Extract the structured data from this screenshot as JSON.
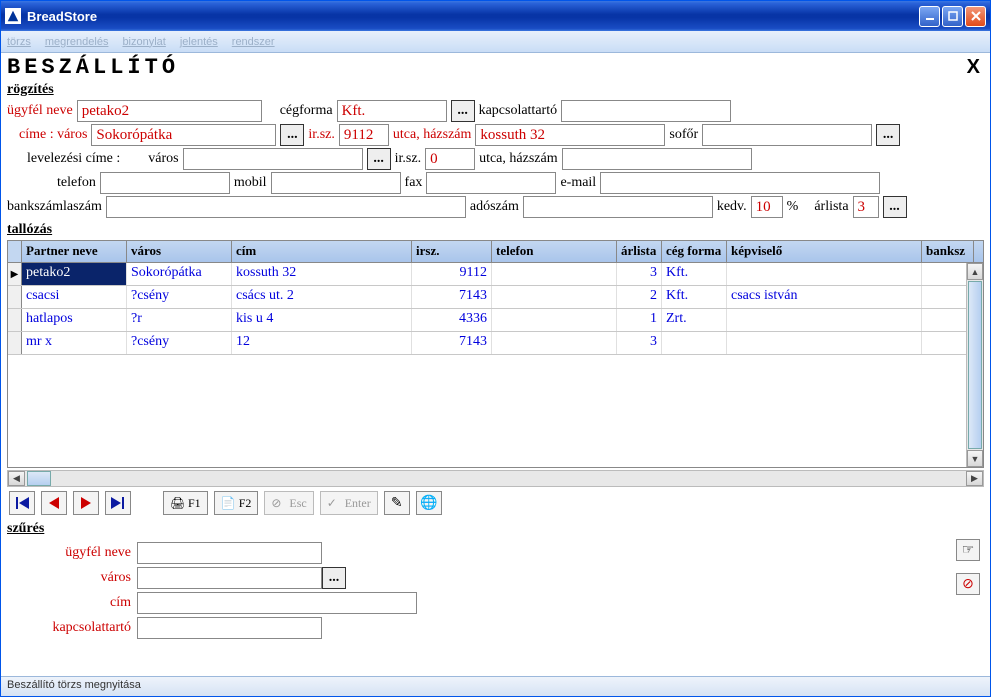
{
  "window": {
    "title": "BreadStore"
  },
  "menu": [
    "törzs",
    "megrendelés",
    "bizonylat",
    "jelentés",
    "rendszer"
  ],
  "page": {
    "title": "BESZÁLLÍTÓ",
    "close": "X"
  },
  "sections": {
    "rogzites": "rögzítés",
    "tallozas": "tallózás",
    "szures": "szűrés"
  },
  "labels": {
    "ugyfel_neve": "ügyfél neve",
    "cegforma": "cégforma",
    "kapcsolattarto": "kapcsolattartó",
    "cime_varos": "címe : város",
    "irsz": "ir.sz.",
    "utca_hazszam": "utca, házszám",
    "sofor": "sofőr",
    "levelezesi_cime": "levelezési címe :",
    "varos": "város",
    "telefon": "telefon",
    "mobil": "mobil",
    "fax": "fax",
    "email": "e-mail",
    "bankszamlaszam": "bankszámlaszám",
    "adoszam": "adószám",
    "kedv": "kedv.",
    "percent": "%",
    "arlista": "árlista",
    "cim": "cím",
    "dots": "..."
  },
  "form": {
    "ugyfel_neve": "petako2",
    "cegforma": "Kft.",
    "kapcsolattarto": "",
    "varos": "Sokorópátka",
    "irsz": "9112",
    "utca": "kossuth 32",
    "sofor": "",
    "lev_varos": "",
    "lev_irsz": "0",
    "lev_utca": "",
    "telefon": "",
    "mobil": "",
    "fax": "",
    "email": "",
    "bankszam": "",
    "adoszam": "",
    "kedv": "10",
    "arlista": "3"
  },
  "table": {
    "headers": {
      "partner": "Partner neve",
      "varos": "város",
      "cim": "cím",
      "irsz": "irsz.",
      "telefon": "telefon",
      "arlista": "árlista",
      "cegforma": "cég forma",
      "kepviselo": "képviselő",
      "banksz": "banksz"
    },
    "rows": [
      {
        "partner": "petako2",
        "varos": "Sokorópátka",
        "cim": "kossuth 32",
        "irsz": "9112",
        "telefon": "",
        "arlista": "3",
        "cegforma": "Kft.",
        "kepviselo": "",
        "selected": true
      },
      {
        "partner": "csacsi",
        "varos": "?csény",
        "cim": "csács ut. 2",
        "irsz": "7143",
        "telefon": "",
        "arlista": "2",
        "cegforma": "Kft.",
        "kepviselo": "csacs istván"
      },
      {
        "partner": "hatlapos",
        "varos": "?r",
        "cim": "kis u 4",
        "irsz": "4336",
        "telefon": "",
        "arlista": "1",
        "cegforma": "Zrt.",
        "kepviselo": ""
      },
      {
        "partner": "mr x",
        "varos": "?csény",
        "cim": "12",
        "irsz": "7143",
        "telefon": "",
        "arlista": "3",
        "cegforma": "",
        "kepviselo": ""
      }
    ]
  },
  "toolbar": {
    "f1": "F1",
    "f2": "F2",
    "esc": "Esc",
    "enter": "Enter"
  },
  "filter": {
    "ugyfel_neve": "",
    "varos": "",
    "cim": "",
    "kapcsolattarto": ""
  },
  "status": "Beszállító törzs megnyitása"
}
